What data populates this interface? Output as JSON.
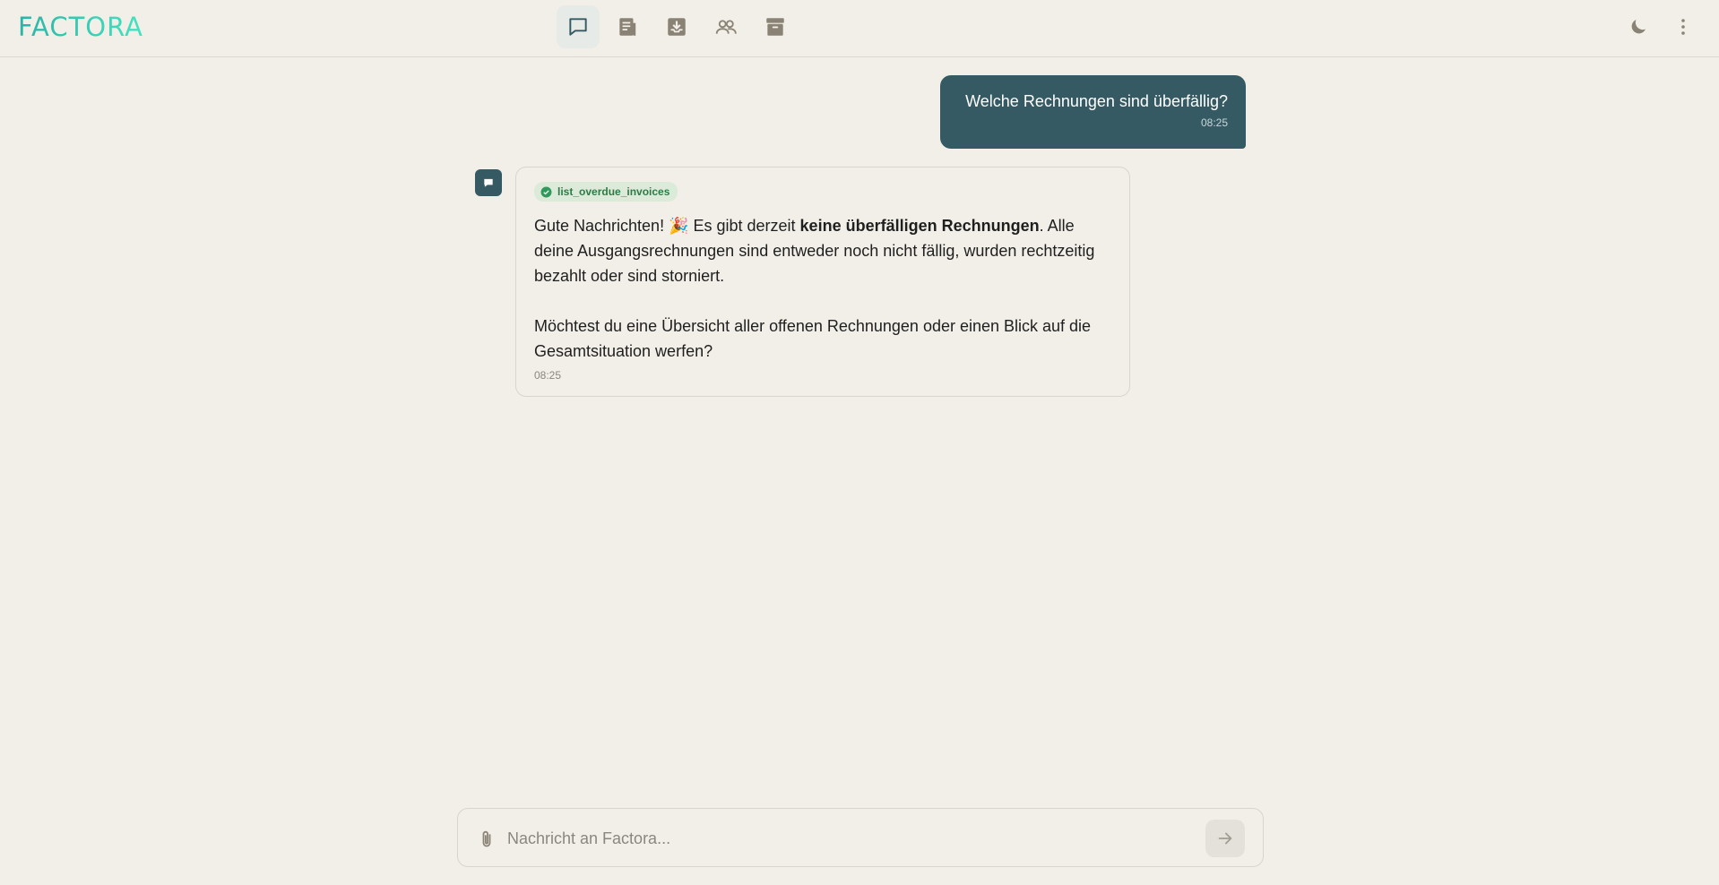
{
  "app": {
    "logo_text": "FACTORA"
  },
  "nav": {
    "items": [
      {
        "name": "chat",
        "icon": "chat-bubble-icon",
        "active": true
      },
      {
        "name": "invoices",
        "icon": "receipt-icon",
        "active": false
      },
      {
        "name": "inbox",
        "icon": "inbox-download-icon",
        "active": false
      },
      {
        "name": "contacts",
        "icon": "users-icon",
        "active": false
      },
      {
        "name": "archive",
        "icon": "archive-box-icon",
        "active": false
      }
    ]
  },
  "header_actions": {
    "theme_icon": "moon-icon",
    "menu_icon": "more-vertical-icon"
  },
  "chat": {
    "user_message": {
      "text": "Welche Rechnungen sind überfällig?",
      "time": "08:25"
    },
    "bot_message": {
      "tool": "list_overdue_invoices",
      "p1_before": "Gute Nachrichten! 🎉 Es gibt derzeit ",
      "p1_bold": "keine überfälligen Rechnungen",
      "p1_after": ". Alle deine Ausgangsrechnungen sind entweder noch nicht fällig, wurden rechtzeitig bezahlt oder sind storniert.",
      "p2": "Möchtest du eine Übersicht aller offenen Rechnungen oder einen Blick auf die Gesamtsituation werfen?",
      "time": "08:25"
    }
  },
  "composer": {
    "placeholder": "Nachricht an Factora...",
    "value": ""
  },
  "colors": {
    "accent": "#355a63",
    "logo_start": "#2bb3a6",
    "logo_end": "#44e3c1",
    "background": "#f2efe8",
    "badge_bg": "#dcebd9",
    "badge_text": "#2f7a47"
  }
}
